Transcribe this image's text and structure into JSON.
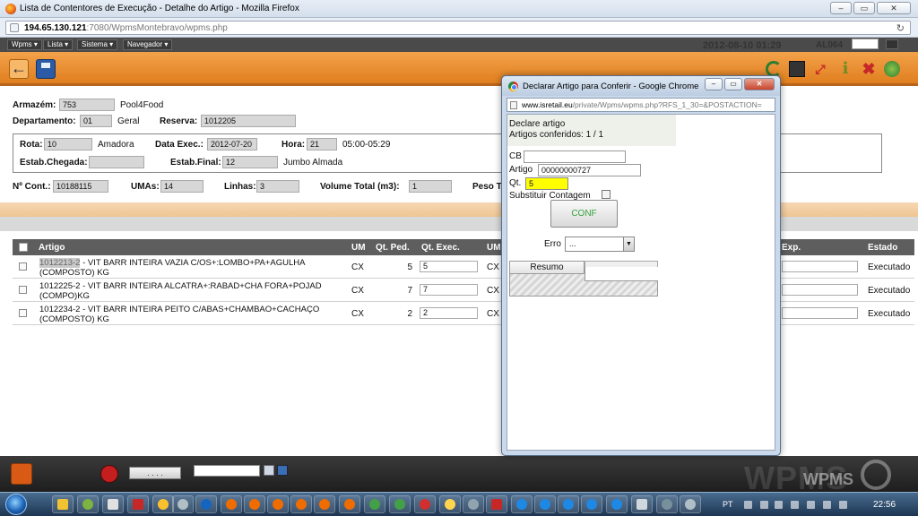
{
  "firefox": {
    "title": "Lista de Contentores de Execução - Detalhe do Artigo - Mozilla Firefox",
    "url_host": "194.65.130.121",
    "url_path": ":7080/WpmsMontebravo/wpms.php"
  },
  "app": {
    "menu": [
      "Wpms ▾",
      "Lista ▾",
      "Sistema ▾",
      "Navegador ▾"
    ],
    "datetime": "2012-08-10 01:29",
    "user": "AL064"
  },
  "form": {
    "armazem_label": "Armazém:",
    "armazem_code": "753",
    "armazem_name": "Pool4Food",
    "departamento_label": "Departamento:",
    "departamento_code": "01",
    "departamento_name": "Geral",
    "reserva_label": "Reserva:",
    "reserva_value": "1012205",
    "rota_label": "Rota:",
    "rota_code": "10",
    "rota_name": "Amadora",
    "data_exec_label": "Data Exec.:",
    "data_exec_value": "2012-07-20",
    "hora_label": "Hora:",
    "hora_value": "21",
    "hora_range": "05:00-05:29",
    "estab_chegada_label": "Estab.Chegada:",
    "estab_chegada_value": "",
    "estab_final_label": "Estab.Final:",
    "estab_final_code": "12",
    "estab_final_name": "Jumbo Almada",
    "ncont_label": "Nº Cont.:",
    "ncont_value": "10188115",
    "umas_label": "UMAs:",
    "umas_value": "14",
    "linhas_label": "Linhas:",
    "linhas_value": "3",
    "volume_label": "Volume Total (m3):",
    "volume_value": "1",
    "peso_label": "Peso T"
  },
  "table": {
    "headers": {
      "artigo": "Artigo",
      "um": "UM",
      "qt_ped": "Qt. Ped.",
      "qt_exec": "Qt. Exec.",
      "um2": "UM",
      "exp": "Exp.",
      "estado": "Estado"
    },
    "rows": [
      {
        "code": "1012213-2",
        "desc": " - VIT BARR INTEIRA VAZIA C/OS+:LOMBO+PA+AGULHA (COMPOSTO) KG",
        "um": "CX",
        "qt_ped": "5",
        "qt_exec": "5",
        "um2": "CX",
        "estado": "Executado"
      },
      {
        "code": "1012225-2",
        "desc": " - VIT BARR INTEIRA ALCATRA+:RABAD+CHA FORA+POJAD (COMPO)KG",
        "um": "CX",
        "qt_ped": "7",
        "qt_exec": "7",
        "um2": "CX",
        "estado": "Executado"
      },
      {
        "code": "1012234-2",
        "desc": " - VIT BARR INTEIRA PEITO C/ABAS+CHAMBAO+CACHAÇO (COMPOSTO) KG",
        "um": "CX",
        "qt_ped": "2",
        "qt_exec": "2",
        "um2": "CX",
        "estado": "Executado"
      }
    ]
  },
  "bottom": {
    "dots_button": ". . . .",
    "logo_text": "WPMS",
    "logo_sub": "WPMS"
  },
  "popup": {
    "title": "Declarar Artigo para Conferir - Google Chrome",
    "url_host": "www.isretail.eu",
    "url_path": "/private/Wpms/wpms.php?RFS_1_30=&POSTACTION=",
    "heading": "Declare artigo",
    "conferidos": "Artigos conferidos: 1 / 1",
    "cb_label": "CB",
    "cb_value": "",
    "artigo_label": "Artigo",
    "artigo_value": "00000000727",
    "qt_label": "Qt.",
    "qt_value": "5",
    "substituir_label": "Substituir Contagem",
    "conf_button": "CONF",
    "erro_label": "Erro",
    "erro_value": "...",
    "resumo_tab": "Resumo"
  },
  "taskbar": {
    "lang": "PT",
    "clock": "22:56"
  }
}
